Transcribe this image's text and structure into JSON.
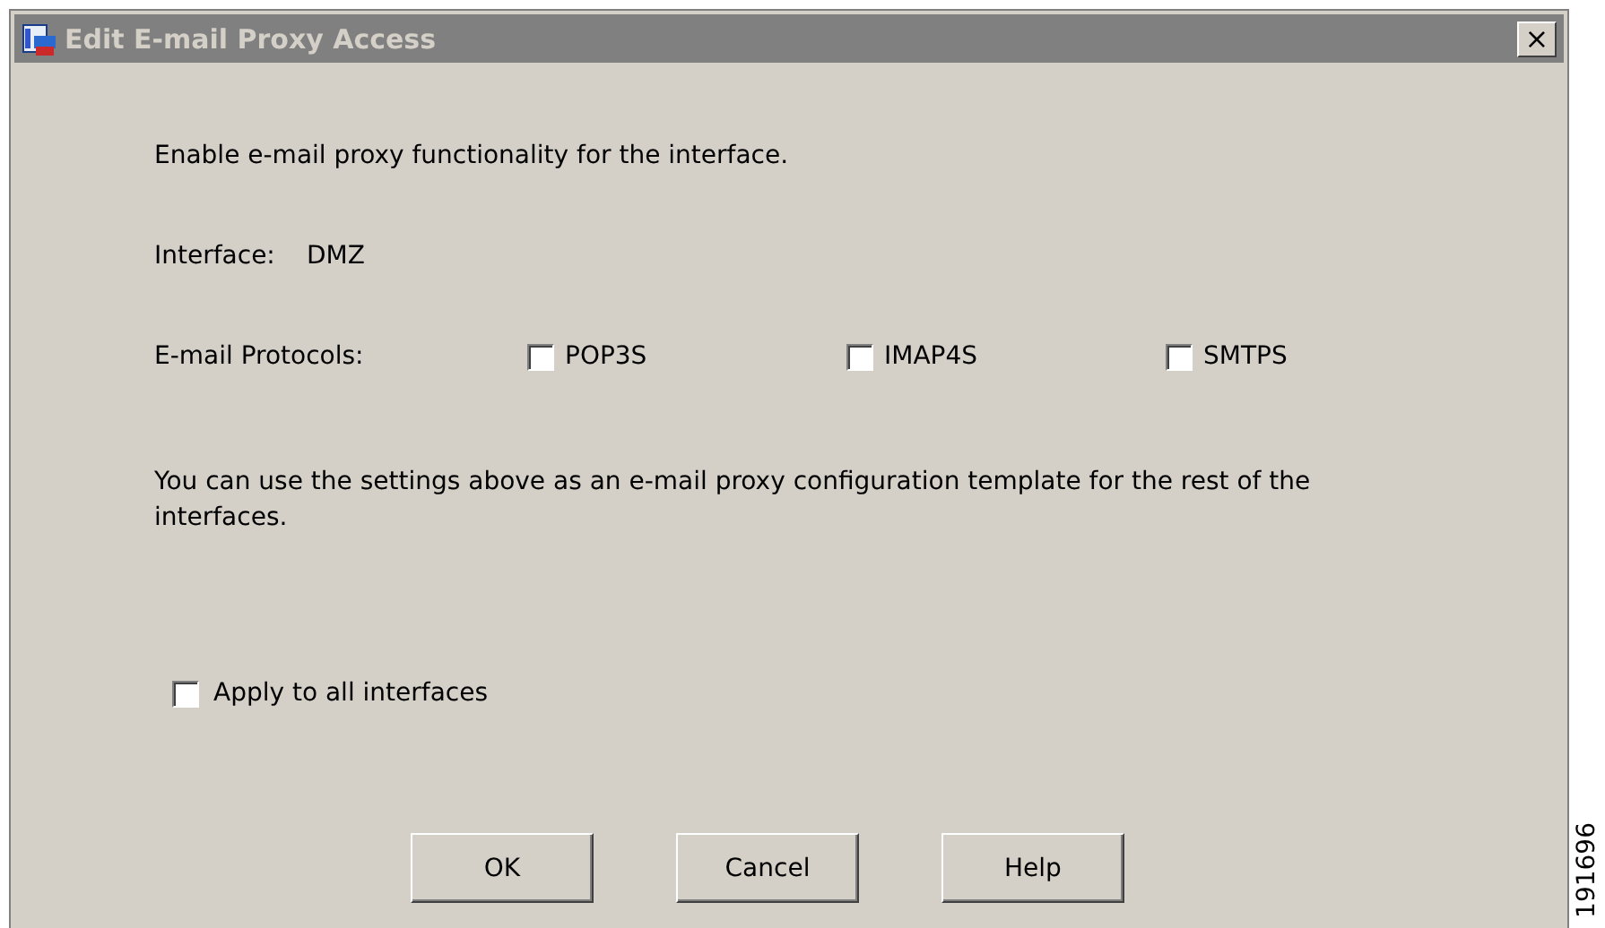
{
  "window": {
    "title": "Edit E-mail Proxy Access",
    "close": "×"
  },
  "intro": "Enable e-mail proxy functionality for the interface.",
  "interface": {
    "label": "Interface:",
    "value": "DMZ"
  },
  "protocols": {
    "label": "E-mail Protocols:",
    "items": [
      {
        "label": "POP3S",
        "checked": false
      },
      {
        "label": "IMAP4S",
        "checked": false
      },
      {
        "label": "SMTPS",
        "checked": false
      }
    ]
  },
  "note": "You can use the settings above as an e-mail proxy configuration template for the rest of the interfaces.",
  "apply_all": {
    "label": "Apply to all interfaces",
    "checked": false
  },
  "buttons": [
    "OK",
    "Cancel",
    "Help"
  ],
  "figure_id": "191696"
}
